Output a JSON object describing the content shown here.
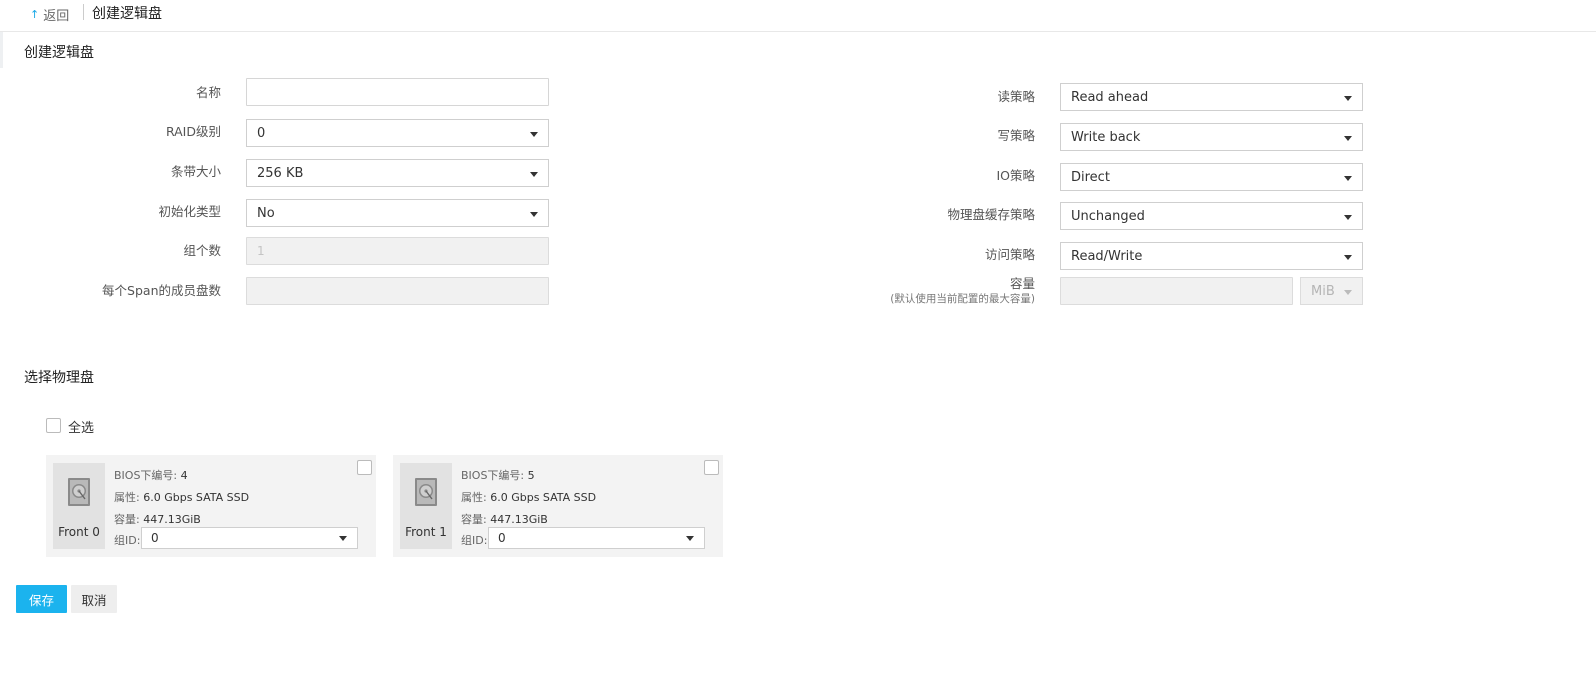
{
  "header": {
    "back_label": "返回",
    "back_icon": "↑",
    "title": "创建逻辑盘"
  },
  "form_section": {
    "title": "创建逻辑盘",
    "left_fields": {
      "name": {
        "label": "名称",
        "value": ""
      },
      "raid_level": {
        "label": "RAID级别",
        "value": "0"
      },
      "strip_size": {
        "label": "条带大小",
        "value": "256 KB"
      },
      "init_type": {
        "label": "初始化类型",
        "value": "No"
      },
      "span_count": {
        "label": "组个数",
        "placeholder": "1"
      },
      "drives_per_span": {
        "label": "每个Span的成员盘数",
        "value": ""
      }
    },
    "right_fields": {
      "read_policy": {
        "label": "读策略",
        "value": "Read ahead"
      },
      "write_policy": {
        "label": "写策略",
        "value": "Write back"
      },
      "io_policy": {
        "label": "IO策略",
        "value": "Direct"
      },
      "disk_cache_policy": {
        "label": "物理盘缓存策略",
        "value": "Unchanged"
      },
      "access_policy": {
        "label": "访问策略",
        "value": "Read/Write"
      },
      "capacity": {
        "label": "容量",
        "sublabel": "(默认使用当前配置的最大容量)",
        "value": "",
        "unit": "MiB"
      }
    }
  },
  "disk_section": {
    "title": "选择物理盘",
    "select_all_label": "全选",
    "disks": [
      {
        "name": "Front 0",
        "bios_label": "BIOS下编号:",
        "bios_value": "4",
        "attr_label": "属性:",
        "attr_value": "6.0 Gbps SATA SSD",
        "cap_label": "容量:",
        "cap_value": "447.13GiB",
        "group_label": "组ID:",
        "group_value": "0",
        "icon": "hard-disk-icon"
      },
      {
        "name": "Front 1",
        "bios_label": "BIOS下编号:",
        "bios_value": "5",
        "attr_label": "属性:",
        "attr_value": "6.0 Gbps SATA SSD",
        "cap_label": "容量:",
        "cap_value": "447.13GiB",
        "group_label": "组ID:",
        "group_value": "0",
        "icon": "hard-disk-icon"
      }
    ]
  },
  "actions": {
    "save_label": "保存",
    "cancel_label": "取消"
  },
  "colors": {
    "primary": "#1bb3ee",
    "back_icon": "#19a8e6",
    "card_bg": "#f3f3f3"
  }
}
